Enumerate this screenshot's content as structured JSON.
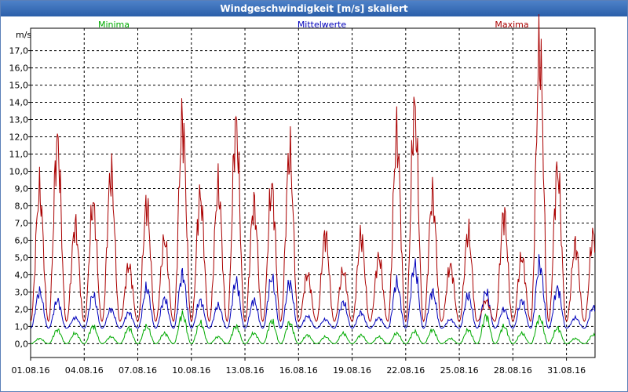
{
  "window": {
    "title": "Windgeschwindigkeit [m/s] skaliert"
  },
  "chart_data": {
    "type": "line",
    "title": "Windgeschwindigkeit [m/s] skaliert",
    "ylabel": "m/s",
    "xlabel": "",
    "ylim": [
      -0.8,
      18.3
    ],
    "xlim": [
      0,
      31.6
    ],
    "grid": true,
    "legend_placement": "top",
    "yticks": [
      "0,0",
      "1,0",
      "2,0",
      "3,0",
      "4,0",
      "5,0",
      "6,0",
      "7,0",
      "8,0",
      "9,0",
      "10,0",
      "11,0",
      "12,0",
      "13,0",
      "14,0",
      "15,0",
      "16,0",
      "17,0"
    ],
    "xticks": [
      {
        "day": 0,
        "label": "01.08.16"
      },
      {
        "day": 3,
        "label": "04.08.16"
      },
      {
        "day": 6,
        "label": "07.08.16"
      },
      {
        "day": 9,
        "label": "10.08.16"
      },
      {
        "day": 12,
        "label": "13.08.16"
      },
      {
        "day": 15,
        "label": "16.08.16"
      },
      {
        "day": 18,
        "label": "19.08.16"
      },
      {
        "day": 21,
        "label": "22.08.16"
      },
      {
        "day": 24,
        "label": "25.08.16"
      },
      {
        "day": 27,
        "label": "28.08.16"
      },
      {
        "day": 30,
        "label": "31.08.16"
      }
    ],
    "series": [
      {
        "name": "Minima",
        "color": "#00aa00",
        "values": [
          0.3,
          0.8,
          0.6,
          1.0,
          0.4,
          0.9,
          1.0,
          0.6,
          1.7,
          1.2,
          0.4,
          1.0,
          0.6,
          1.3,
          1.2,
          0.5,
          0.4,
          0.6,
          0.5,
          0.4,
          0.6,
          0.7,
          0.8,
          0.3,
          0.8,
          1.6,
          1.0,
          0.6,
          1.5,
          0.9,
          0.3,
          0.5
        ]
      },
      {
        "name": "Mittelwerte",
        "color": "#0000bb",
        "values": [
          3.0,
          2.5,
          1.5,
          2.8,
          2.0,
          1.8,
          3.2,
          2.6,
          4.0,
          2.5,
          2.2,
          3.6,
          2.5,
          3.8,
          3.5,
          1.6,
          1.4,
          2.4,
          1.8,
          1.5,
          3.5,
          4.5,
          3.0,
          1.4,
          2.8,
          3.0,
          2.0,
          2.5,
          4.6,
          3.2,
          1.5,
          2.1
        ]
      },
      {
        "name": "Maxima",
        "color": "#aa0000",
        "values": [
          8.8,
          11.6,
          6.8,
          8.0,
          9.8,
          4.5,
          8.0,
          6.0,
          12.8,
          8.5,
          9.0,
          12.6,
          8.0,
          9.0,
          11.0,
          4.0,
          6.3,
          4.2,
          6.2,
          5.0,
          12.0,
          13.5,
          8.5,
          4.5,
          6.4,
          2.5,
          7.5,
          5.0,
          16.9,
          10.0,
          5.7,
          6.3
        ]
      }
    ]
  }
}
